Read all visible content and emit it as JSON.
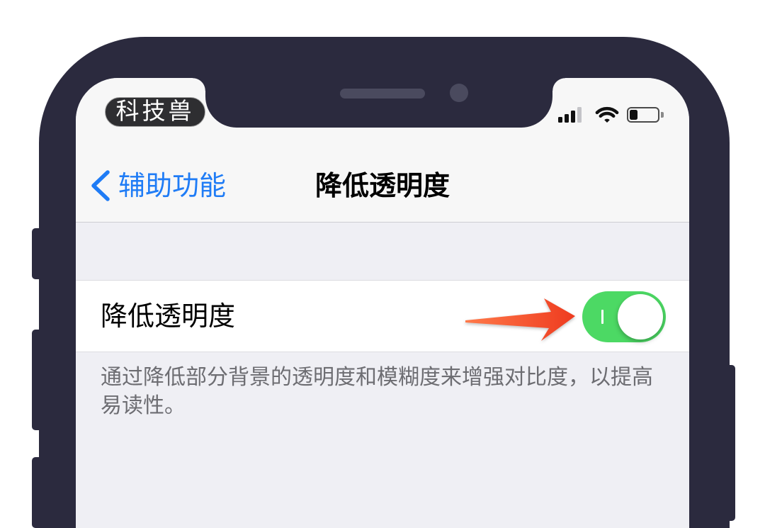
{
  "watermark": {
    "text": "科技兽"
  },
  "status_bar": {
    "signal_icon": "cellular-signal-icon",
    "signal_bars": 3,
    "signal_bars_max": 4,
    "wifi_icon": "wifi-icon",
    "battery_icon": "battery-icon",
    "battery_level": 0.3
  },
  "nav": {
    "back_icon": "chevron-left-icon",
    "back_label": "辅助功能",
    "title": "降低透明度"
  },
  "setting": {
    "label": "降低透明度",
    "toggle_on": true,
    "toggle_icon": "toggle-switch-icon",
    "toggle_on_indicator_icon": "toggle-on-indicator-icon"
  },
  "footer": {
    "lines": [
      "通过降低部分背景的透明度和模糊度来增强对比度，以提高",
      "易读性。"
    ]
  },
  "annotation": {
    "arrow_icon": "red-arrow-icon"
  },
  "colors": {
    "phone_frame": "#2b2a3e",
    "accent": "#1f7cf6",
    "toggle_on": "#4cd964",
    "arrow": "#ee3b1f",
    "grouped_background": "#efeff4",
    "nav_background": "#f7f7f7",
    "footer_text": "#6d6d72"
  }
}
